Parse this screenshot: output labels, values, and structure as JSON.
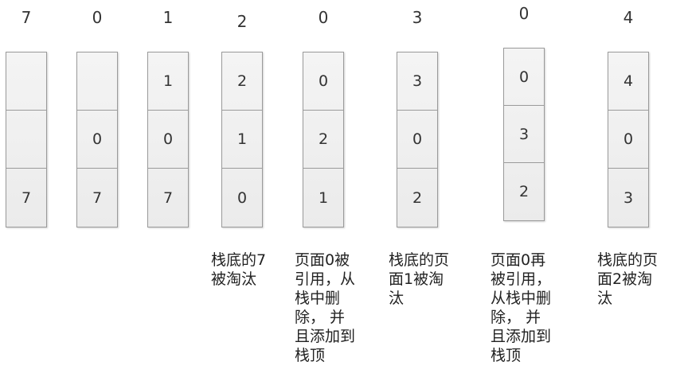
{
  "columns": [
    {
      "ref": "7",
      "cells": [
        "",
        "",
        "7"
      ]
    },
    {
      "ref": "0",
      "cells": [
        "",
        "0",
        "7"
      ]
    },
    {
      "ref": "1",
      "cells": [
        "1",
        "0",
        "7"
      ]
    },
    {
      "ref": "2",
      "cells": [
        "2",
        "1",
        "0"
      ]
    },
    {
      "ref": "0",
      "cells": [
        "0",
        "2",
        "1"
      ]
    },
    {
      "ref": "3",
      "cells": [
        "3",
        "0",
        "2"
      ]
    },
    {
      "ref": "0",
      "cells": [
        "0",
        "3",
        "2"
      ]
    },
    {
      "ref": "4",
      "cells": [
        "4",
        "0",
        "3"
      ]
    }
  ],
  "notes": [
    {
      "col": 3,
      "text": "栈底的7\n被淘汰"
    },
    {
      "col": 4,
      "text": "页面0被\n引用，从\n栈中删\n除， 并\n且添加到\n栈顶"
    },
    {
      "col": 5,
      "text": "栈底的页\n面1被淘\n汰"
    },
    {
      "col": 6,
      "text": "页面0再\n被引用，\n从栈中删\n除， 并\n且添加到\n栈顶"
    },
    {
      "col": 7,
      "text": "栈底的页\n面2被淘\n汰"
    }
  ]
}
